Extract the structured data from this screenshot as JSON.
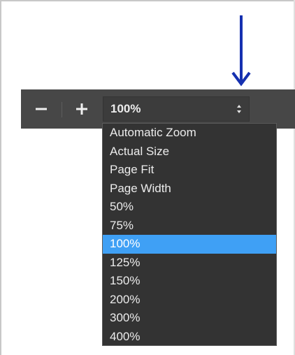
{
  "toolbar": {
    "zoom_out_icon": "minus-icon",
    "zoom_in_icon": "plus-icon",
    "zoom_value": "100%"
  },
  "annotation": {
    "arrow_icon": "down-arrow-icon",
    "arrow_color": "#1530b0"
  },
  "dropdown": {
    "selected": "100%",
    "selected_color": "#3fa0f5",
    "options": [
      "Automatic Zoom",
      "Actual Size",
      "Page Fit",
      "Page Width",
      "50%",
      "75%",
      "100%",
      "125%",
      "150%",
      "200%",
      "300%",
      "400%"
    ]
  }
}
